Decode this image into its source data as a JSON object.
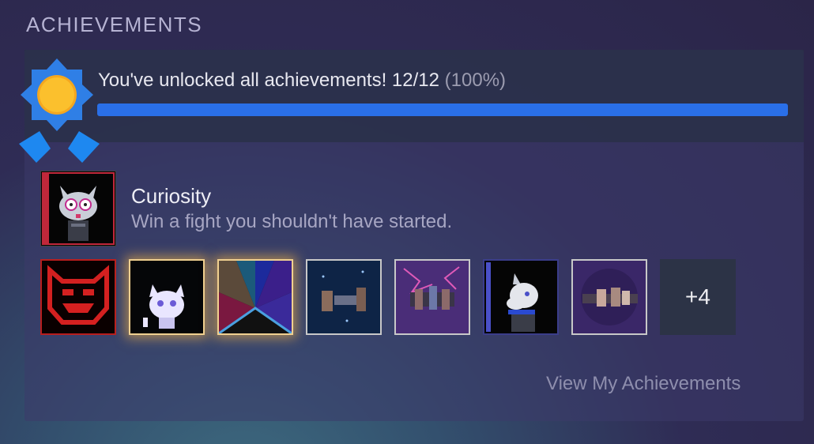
{
  "section": {
    "title": "ACHIEVEMENTS"
  },
  "summary": {
    "text": "You've unlocked all achievements! 12/12",
    "percent_text": "(100%)",
    "progress": 1.0,
    "accent_color": "#2a6fe8"
  },
  "featured": {
    "icon": "curiosity-character-icon",
    "title": "Curiosity",
    "description": "Win a fight you shouldn't have started."
  },
  "achievement_icons": [
    {
      "icon": "red-demon-face-icon"
    },
    {
      "icon": "white-cat-peace-icon"
    },
    {
      "icon": "stained-glass-icon"
    },
    {
      "icon": "ship-blue-space-icon"
    },
    {
      "icon": "ship-purple-lightning-icon"
    },
    {
      "icon": "goat-character-icon"
    },
    {
      "icon": "ship-purple-nebula-icon"
    }
  ],
  "more": {
    "label": "+4"
  },
  "footer": {
    "link_label": "View My Achievements"
  }
}
